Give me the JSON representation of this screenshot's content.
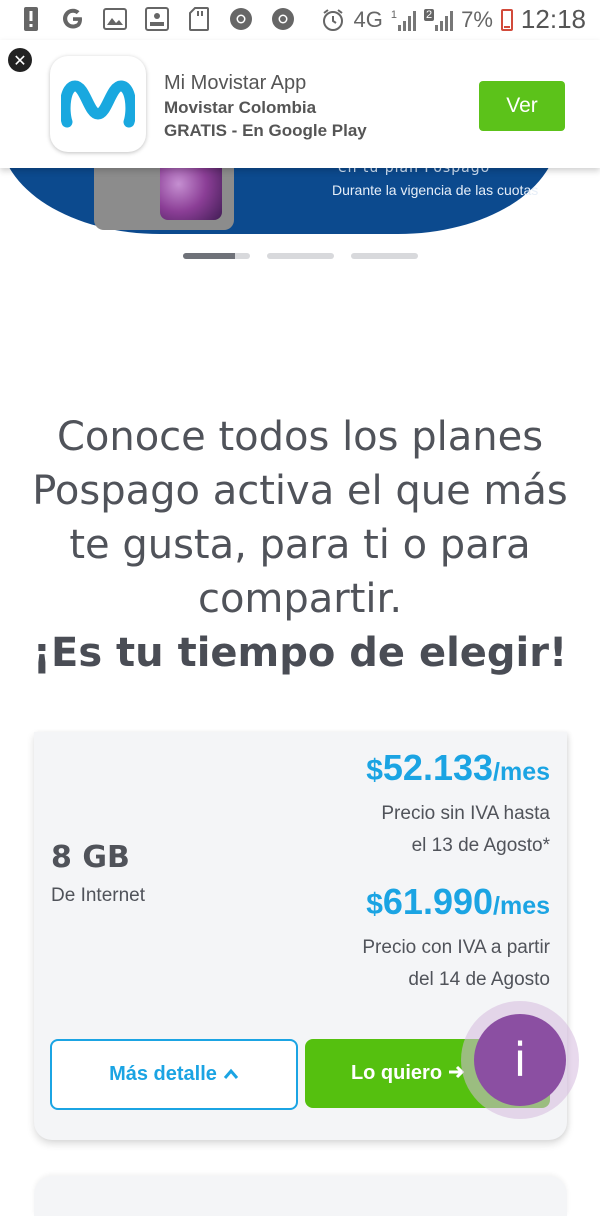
{
  "status_bar": {
    "network": "4G",
    "sim1": "1",
    "sim2": "2",
    "battery": "7%",
    "time": "12:18",
    "left_icons": [
      "alert-icon",
      "google-icon",
      "gallery-icon",
      "screen-record-icon",
      "sd-card-icon",
      "chrome-icon",
      "chrome-icon"
    ],
    "battery_color": "#d24a3a"
  },
  "app_banner": {
    "app_name": "Mi Movistar App",
    "publisher": "Movistar Colombia",
    "price_line": "GRATIS - En Google Play",
    "cta_label": "Ver",
    "close_icon": "close-icon",
    "logo_color": "#19a8df",
    "cta_color": "#5cc21a"
  },
  "hero": {
    "partial_title": "en tu plan Pospago",
    "caption": "Durante la vigencia de las cuotas",
    "slides": 3,
    "active_slide": 1,
    "background_color": "#0c4a8e"
  },
  "headline": {
    "lines": [
      "Conoce todos los planes",
      "Pospago activa el que más",
      "te gusta, para ti o para",
      "compartir."
    ],
    "emphasis": "¡Es tu tiempo de elegir!"
  },
  "plan": {
    "data_amount": "8 GB",
    "data_label": "De Internet",
    "price1": {
      "currency": "$",
      "amount": "52.133",
      "period": "/mes"
    },
    "price1_note_lines": [
      "Precio sin IVA hasta",
      "el 13 de Agosto*"
    ],
    "price2": {
      "currency": "$",
      "amount": "61.990",
      "period": "/mes"
    },
    "price2_note_lines": [
      "Precio con IVA a partir",
      "del 14 de Agosto"
    ],
    "details_label": "Más detalle",
    "buy_label": "Lo quiero",
    "price_color": "#1ba4e3",
    "buy_color": "#55c00f"
  },
  "fab": {
    "label": "i",
    "color": "#8b4fa2"
  }
}
